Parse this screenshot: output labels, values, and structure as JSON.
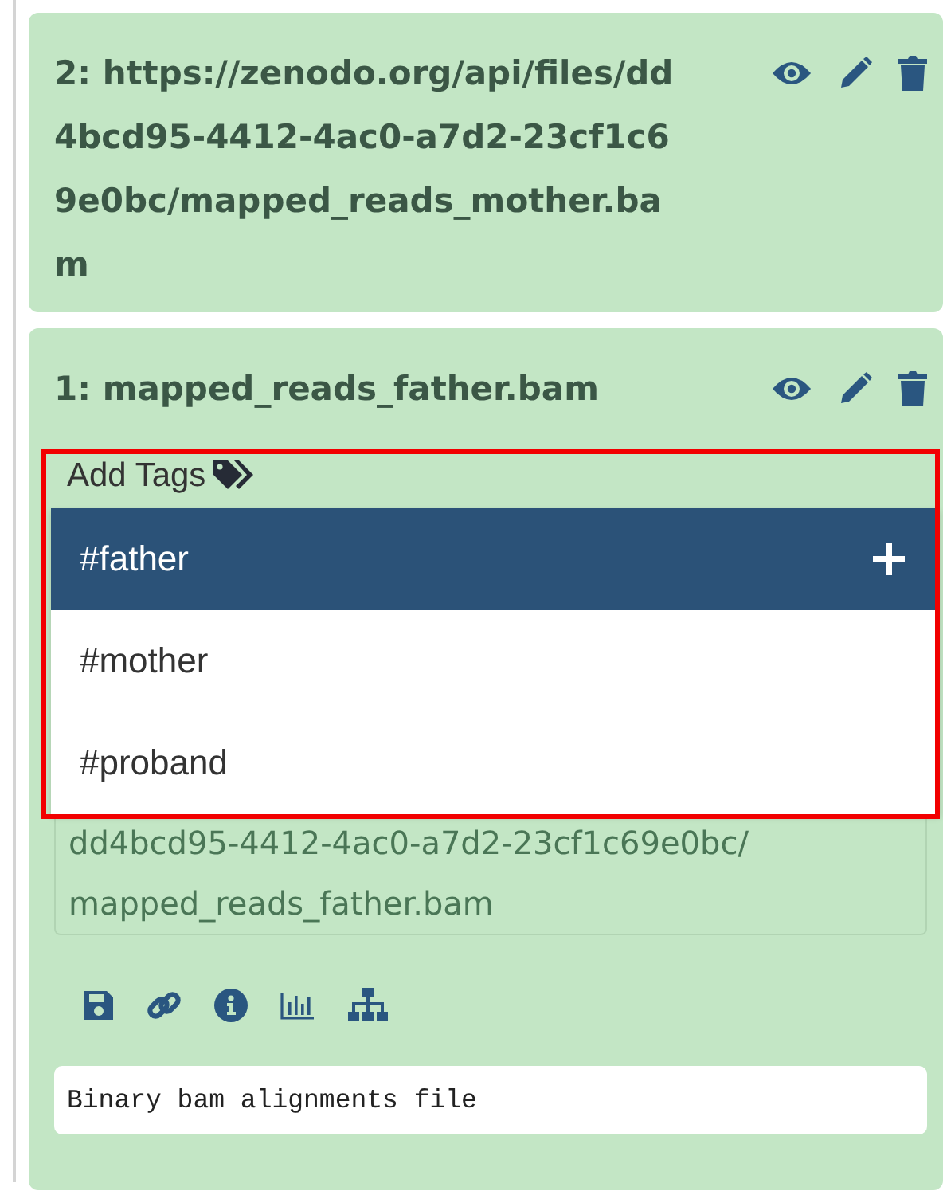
{
  "history_items": [
    {
      "title": "2: https://zenodo.org/api/files/dd4bcd95-4412-4ac0-a7d2-23cf1c69e0bc/mapped_reads_mother.bam",
      "expanded": false
    },
    {
      "title": "1: mapped_reads_father.bam",
      "expanded": true,
      "tag_editor": {
        "label": "Add Tags",
        "suggestions": [
          {
            "text": "#father",
            "selected": true
          },
          {
            "text": "#mother",
            "selected": false
          },
          {
            "text": "#proband",
            "selected": false
          }
        ]
      },
      "info_lines": [
        "dd4bcd95-4412-4ac0-a7d2-23cf1c69e0bc/",
        "mapped_reads_father.bam"
      ],
      "description": "Binary bam alignments file"
    }
  ]
}
